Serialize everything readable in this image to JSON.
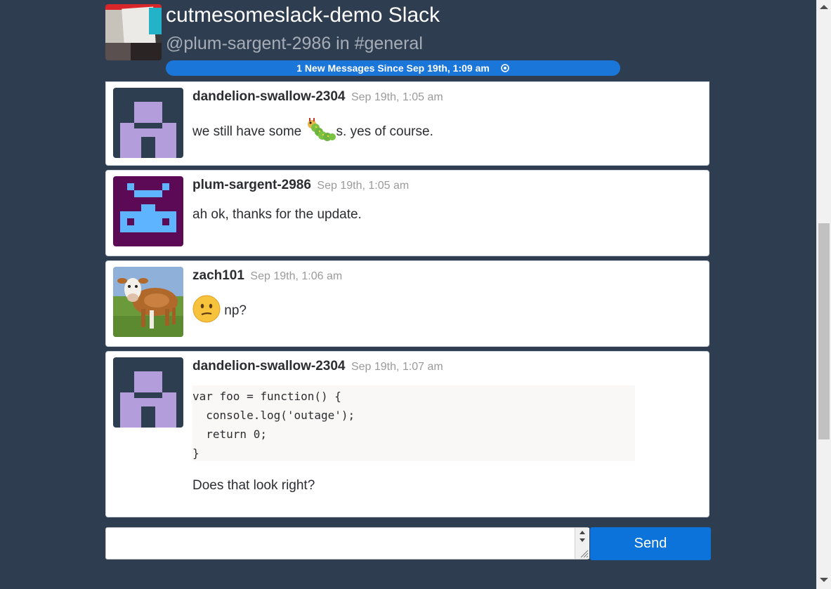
{
  "header": {
    "team_name": "cutmesomeslack-demo Slack",
    "user_channel": "@plum-sargent-2986 in #general",
    "new_messages_banner": "1 New Messages Since Sep 19th, 1:09 am"
  },
  "messages": [
    {
      "user": "dandelion-swallow-2304",
      "time": "Sep 19th, 1:05 am",
      "text_before": "we still have some",
      "emoji": "caterpillar-emoji",
      "text_after": "s. yes of course."
    },
    {
      "user": "plum-sargent-2986",
      "time": "Sep 19th, 1:05 am",
      "text": "ah ok, thanks for the update."
    },
    {
      "user": "zach101",
      "time": "Sep 19th, 1:06 am",
      "emoji": "confused-face-emoji",
      "text": "np?"
    },
    {
      "user": "dandelion-swallow-2304",
      "time": "Sep 19th, 1:07 am",
      "code": [
        "var foo = function() {",
        "  console.log('outage');",
        "  return 0;",
        "}"
      ],
      "text": "Does that look right?"
    }
  ],
  "composer": {
    "value": "",
    "send_label": "Send"
  },
  "colors": {
    "background": "#2f3d50",
    "accent": "#0b73d9",
    "avatar_purple_bg": "#2c3e50",
    "avatar_purple_fg": "#b39ddb",
    "avatar_plum_bg": "#5c0a56",
    "avatar_plum_fg": "#5fb4ff"
  }
}
